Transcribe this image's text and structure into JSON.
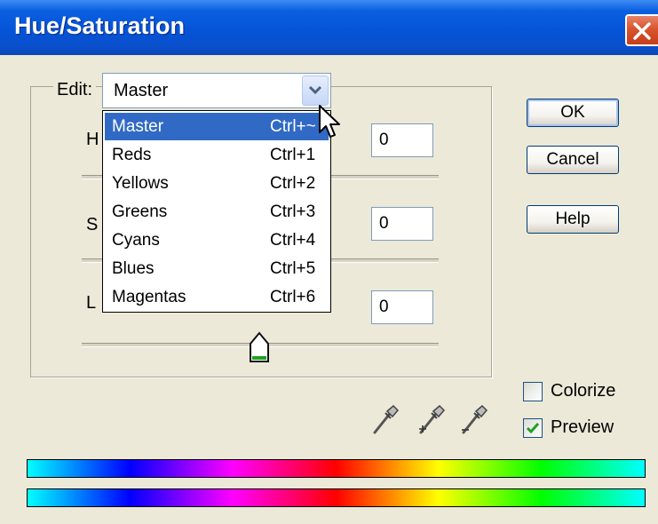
{
  "window": {
    "title": "Hue/Saturation",
    "close_icon": "close-x-icon",
    "colors": {
      "titlebar": "#0554d8",
      "close": "#d9542e",
      "face": "#ece9d8",
      "selection": "#316ac5"
    }
  },
  "edit": {
    "label": "Edit:",
    "value": "Master"
  },
  "dropdown": {
    "items": [
      {
        "name": "Master",
        "shortcut": "Ctrl+~"
      },
      {
        "name": "Reds",
        "shortcut": "Ctrl+1"
      },
      {
        "name": "Yellows",
        "shortcut": "Ctrl+2"
      },
      {
        "name": "Greens",
        "shortcut": "Ctrl+3"
      },
      {
        "name": "Cyans",
        "shortcut": "Ctrl+4"
      },
      {
        "name": "Blues",
        "shortcut": "Ctrl+5"
      },
      {
        "name": "Magentas",
        "shortcut": "Ctrl+6"
      }
    ],
    "selected": "Master"
  },
  "fields": {
    "hue": {
      "label_visible": "H",
      "value": "0"
    },
    "saturation": {
      "label_visible": "S",
      "value": "0"
    },
    "lightness": {
      "label_visible": "L",
      "value": "0"
    }
  },
  "buttons": {
    "ok": "OK",
    "cancel": "Cancel",
    "help": "Help"
  },
  "options": {
    "colorize": {
      "label": "Colorize",
      "checked": false
    },
    "preview": {
      "label": "Preview",
      "checked": true
    }
  },
  "tools": [
    "eyedropper-icon",
    "eyedropper-plus-icon",
    "eyedropper-minus-icon"
  ]
}
